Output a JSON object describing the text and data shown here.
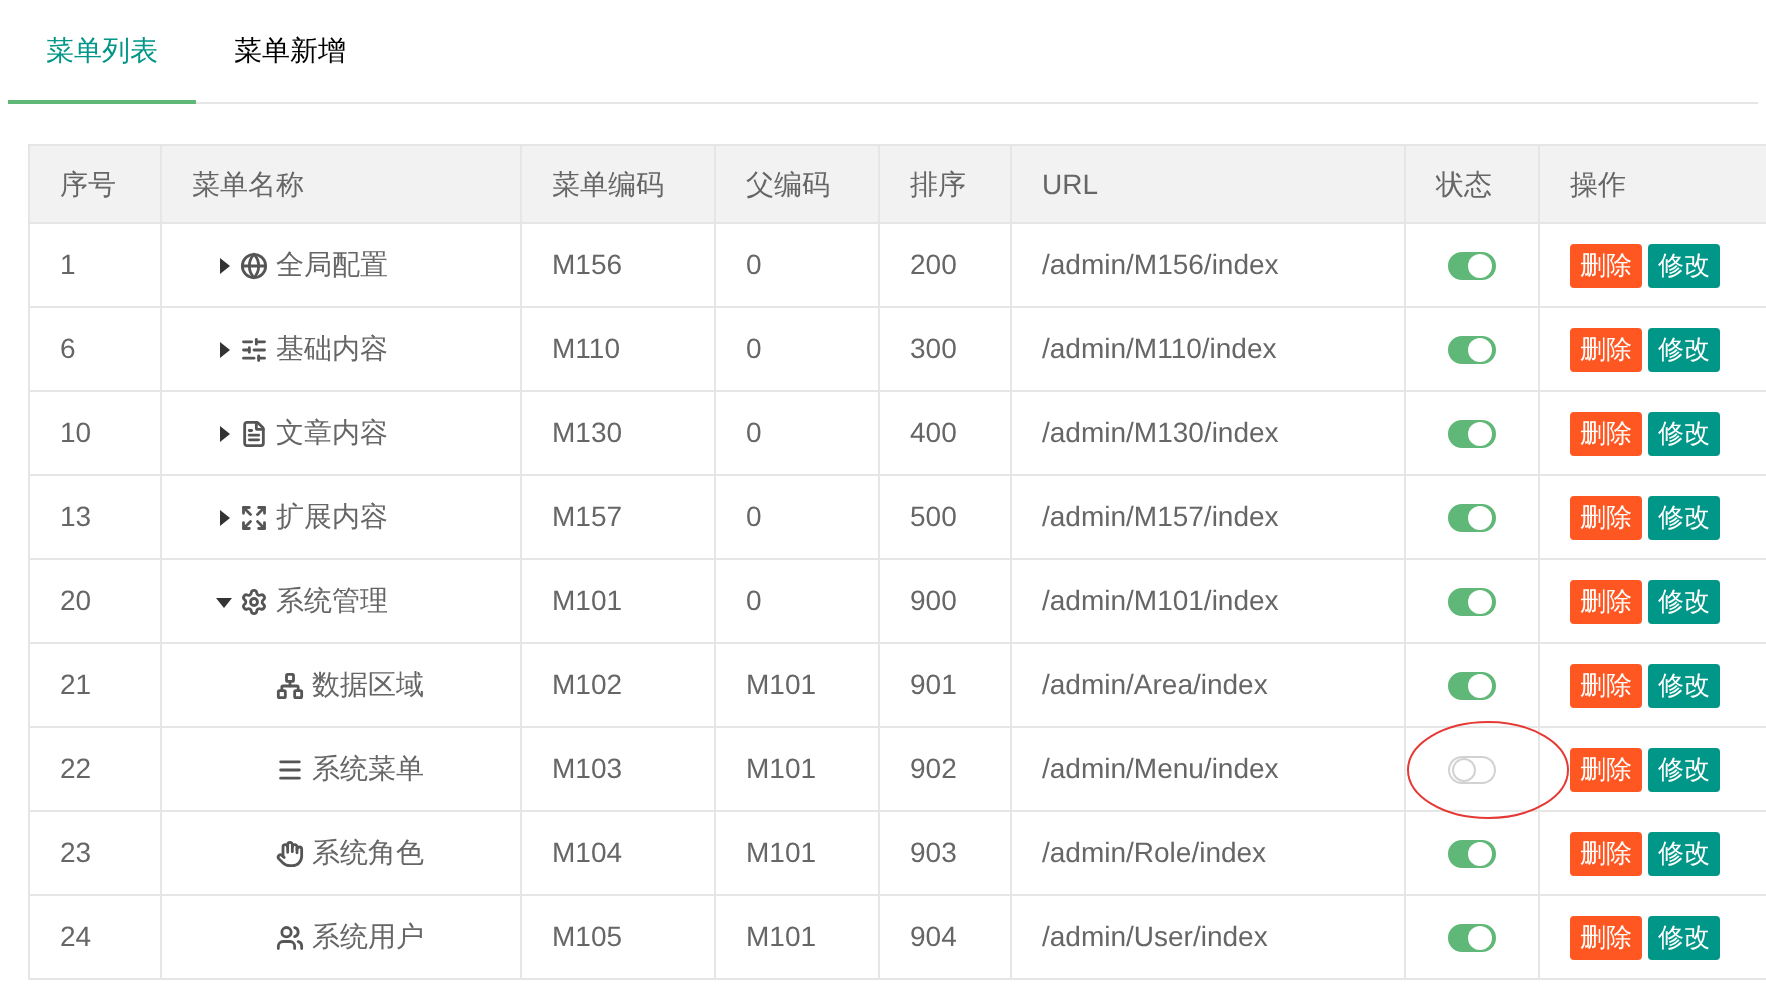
{
  "tabs": [
    {
      "label": "菜单列表",
      "selected": true
    },
    {
      "label": "菜单新增",
      "selected": false
    }
  ],
  "table": {
    "columns": [
      "序号",
      "菜单名称",
      "菜单编码",
      "父编码",
      "排序",
      "URL",
      "状态",
      "操作"
    ],
    "rows": [
      {
        "id": "1",
        "name": "全局配置",
        "code": "M156",
        "parent": "0",
        "sort": "200",
        "url": "/admin/M156/index",
        "on": true,
        "expanded": false,
        "circled": false,
        "actions": [
          "删除",
          "修改"
        ]
      },
      {
        "id": "6",
        "name": "基础内容",
        "code": "M110",
        "parent": "0",
        "sort": "300",
        "url": "/admin/M110/index",
        "on": true,
        "expanded": false,
        "circled": false,
        "actions": [
          "删除",
          "修改"
        ]
      },
      {
        "id": "10",
        "name": "文章内容",
        "code": "M130",
        "parent": "0",
        "sort": "400",
        "url": "/admin/M130/index",
        "on": true,
        "expanded": false,
        "circled": false,
        "actions": [
          "删除",
          "修改"
        ]
      },
      {
        "id": "13",
        "name": "扩展内容",
        "code": "M157",
        "parent": "0",
        "sort": "500",
        "url": "/admin/M157/index",
        "on": true,
        "expanded": false,
        "circled": false,
        "actions": [
          "删除",
          "修改"
        ]
      },
      {
        "id": "20",
        "name": "系统管理",
        "code": "M101",
        "parent": "0",
        "sort": "900",
        "url": "/admin/M101/index",
        "on": true,
        "expanded": true,
        "circled": false,
        "actions": [
          "删除",
          "修改"
        ],
        "children": [
          {
            "id": "21",
            "name": "数据区域",
            "code": "M102",
            "parent": "M101",
            "sort": "901",
            "url": "/admin/Area/index",
            "on": true,
            "circled": false,
            "actions": [
              "删除",
              "修改"
            ]
          },
          {
            "id": "22",
            "name": "系统菜单",
            "code": "M103",
            "parent": "M101",
            "sort": "902",
            "url": "/admin/Menu/index",
            "on": false,
            "circled": true,
            "actions": [
              "删除",
              "修改"
            ]
          },
          {
            "id": "23",
            "name": "系统角色",
            "code": "M104",
            "parent": "M101",
            "sort": "903",
            "url": "/admin/Role/index",
            "on": true,
            "circled": false,
            "actions": [
              "删除",
              "修改"
            ]
          },
          {
            "id": "24",
            "name": "系统用户",
            "code": "M105",
            "parent": "M101",
            "sort": "904",
            "url": "/admin/User/index",
            "on": true,
            "circled": false,
            "actions": [
              "删除",
              "修改"
            ]
          }
        ]
      }
    ]
  }
}
